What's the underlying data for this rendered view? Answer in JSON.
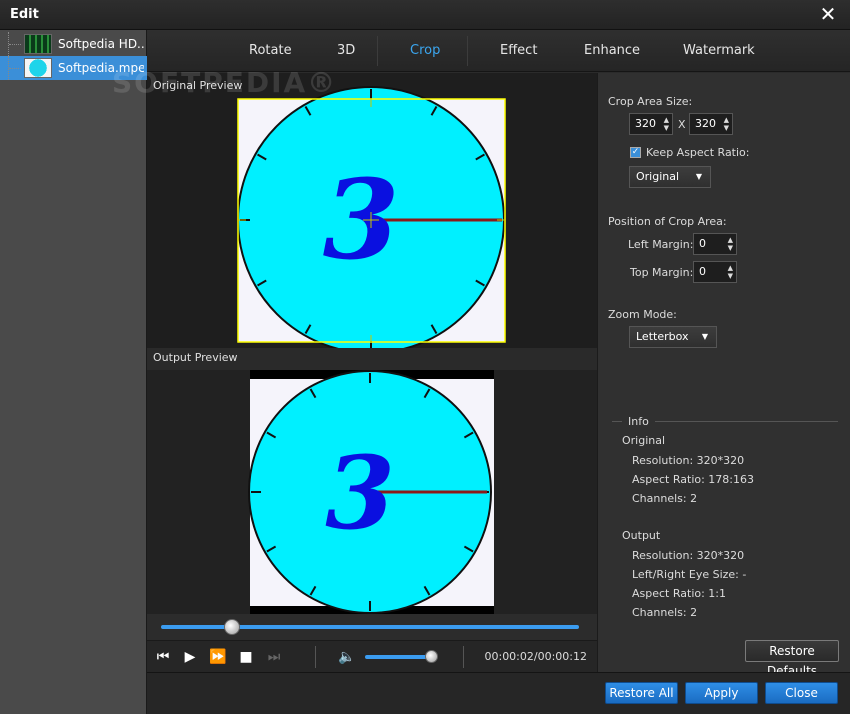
{
  "window": {
    "title": "Edit",
    "close_glyph": "✕"
  },
  "files": [
    {
      "name": "Softpedia HD....",
      "icon": "film-thumbnail-icon"
    },
    {
      "name": "Softpedia.mpeg",
      "icon": "clock-thumbnail-icon",
      "selected": true
    }
  ],
  "watermark": "SOFTPEDIA®",
  "tabs": [
    {
      "label": "Rotate"
    },
    {
      "label": "3D"
    },
    {
      "label": "Crop",
      "active": true
    },
    {
      "label": "Effect"
    },
    {
      "label": "Enhance"
    },
    {
      "label": "Watermark"
    }
  ],
  "previews": {
    "original_label": "Original Preview",
    "output_label": "Output Preview",
    "clock_digit": "3"
  },
  "playback": {
    "seek_progress": 0.17,
    "volume_level": 0.92,
    "time": "00:00:02/00:00:12"
  },
  "crop": {
    "area_size_label": "Crop Area Size:",
    "width": "320",
    "x_sep": "X",
    "height": "320",
    "keep_aspect_label": "Keep Aspect Ratio:",
    "keep_aspect_checked": true,
    "aspect_option": "Original",
    "position_label": "Position of Crop Area:",
    "left_margin_label": "Left Margin:",
    "left_margin": "0",
    "top_margin_label": "Top Margin:",
    "top_margin": "0",
    "zoom_label": "Zoom Mode:",
    "zoom_option": "Letterbox"
  },
  "info": {
    "heading": "Info",
    "original": {
      "heading": "Original",
      "resolution": "Resolution: 320*320",
      "aspect": "Aspect Ratio: 178:163",
      "channels": "Channels: 2"
    },
    "output": {
      "heading": "Output",
      "resolution": "Resolution: 320*320",
      "eye_size": "Left/Right Eye Size: -",
      "aspect": "Aspect Ratio: 1:1",
      "channels": "Channels: 2"
    }
  },
  "buttons": {
    "restore_defaults": "Restore Defaults",
    "restore_all": "Restore All",
    "apply": "Apply",
    "close": "Close"
  },
  "colors": {
    "accent": "#3ba6ef",
    "button_blue": "#1a6cc2",
    "clock_face": "#00f0ff",
    "digit": "#0a10e0",
    "hand": "#8b1a1a",
    "crop_frame": "#ffff00"
  }
}
